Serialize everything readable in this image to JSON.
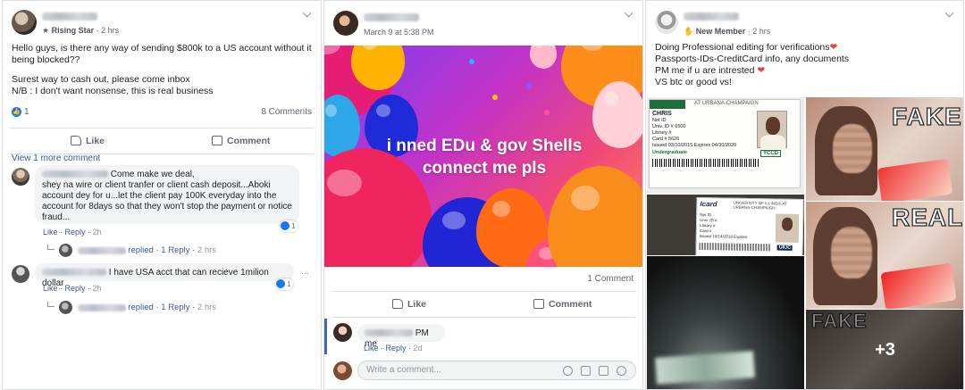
{
  "post1": {
    "badge": "Rising Star",
    "time": "· 2 hrs",
    "lines": [
      "Hello guys, is there any way of sending $800k to a US account without it being blocked??",
      "",
      "Surest way to cash out, please come inbox",
      "N/B : I don't want nonsense, this is real business"
    ],
    "reaction_count": "1",
    "comments_count": "8 Comments",
    "like_label": "Like",
    "comment_label": "Comment",
    "view_more": "View 1 more comment",
    "comment1": {
      "text": "Come make we deal,\nshey na wire or client tranfer or client cash deposit...Aboki account dey for u...let the client pay 100K everyday into the account for 8days so that they won't stop the payment or notice fraud...",
      "like": "Like",
      "reply": "Reply",
      "time": "2h",
      "react_count": "1",
      "replied": "replied",
      "reply_count": "1 Reply",
      "reply_time": "2 hrs"
    },
    "comment2": {
      "text": "I have USA acct that can recieve 1milion dollar",
      "like": "Like",
      "reply": "Reply",
      "time": "2h",
      "react_count": "1",
      "more": "···",
      "replied": "replied",
      "reply_count": "1 Reply",
      "reply_time": "2 hrs"
    }
  },
  "post2": {
    "date": "March 9 at 5:38 PM",
    "image_text_line1": "i nned EDu & gov Shells",
    "image_text_line2": "connect me pls",
    "comments_count": "1 Comment",
    "like_label": "Like",
    "comment_label": "Comment",
    "comment1": {
      "text": "PM me",
      "like": "Like",
      "reply": "Reply",
      "time": "2d"
    },
    "write_placeholder": "Write a comment..."
  },
  "post3": {
    "badge": "New Member",
    "time": "· 2 hrs",
    "line1": "Doing Professional editing for verifications",
    "line2": "Passports-IDs-CreditCard info, any documents",
    "line3": "PM me if u are intrested",
    "line4": "VS btc or good vs!",
    "heart": "❤",
    "card1_header": "AT URBANA-CHAMPAIGN",
    "card1_name": "CHRIS",
    "card1_fields": "Net ID\nUniv. ID # 6500\nLibrary #\nCard # 5626\nIssued 03/10/2015 Expires 04/30/2020",
    "card1_note": "Undergraduate",
    "card1_badge": "YCCD",
    "card2_logo": "Icard",
    "card2_header": "UNIVERSITY OF ILLINOIS AT URBANA-CHAMPAIGN",
    "card2_fields": "Net ID\nUniv. ID #\nLibrary #\nCard #\nIssued 10/14/2018 Expires",
    "card2_badge": "UIUC",
    "label_fake": "FAKE",
    "label_real": "REAL",
    "label_fake2": "FAKE",
    "more_count": "+3"
  },
  "colors": {
    "link": "#385898",
    "facebook_blue": "#1877f2",
    "heart": "#e8443c"
  }
}
